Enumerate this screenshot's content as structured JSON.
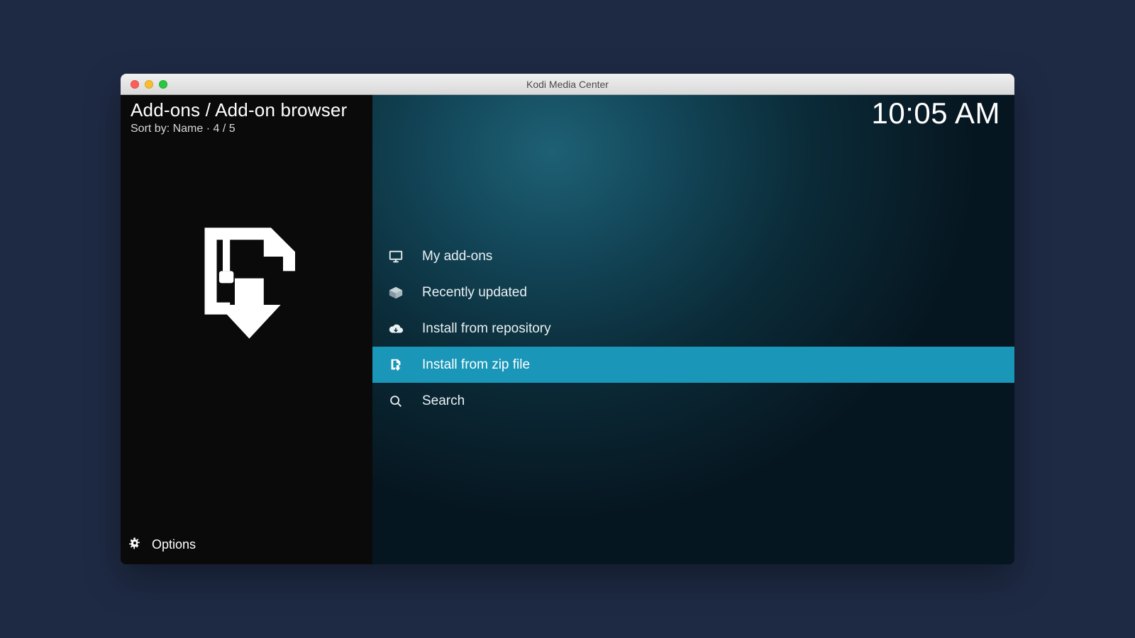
{
  "window": {
    "title": "Kodi Media Center"
  },
  "clock": "10:05 AM",
  "sidebar": {
    "breadcrumb": "Add-ons / Add-on browser",
    "sort_prefix": "Sort by: ",
    "sort_value": "Name",
    "divider": " · ",
    "position": "4 / 5",
    "options_label": "Options"
  },
  "menu": {
    "selected_index": 3,
    "items": [
      {
        "label": "My add-ons",
        "icon": "monitor-icon"
      },
      {
        "label": "Recently updated",
        "icon": "open-box-icon"
      },
      {
        "label": "Install from repository",
        "icon": "cloud-download-icon"
      },
      {
        "label": "Install from zip file",
        "icon": "zip-download-icon"
      },
      {
        "label": "Search",
        "icon": "search-icon"
      }
    ]
  }
}
